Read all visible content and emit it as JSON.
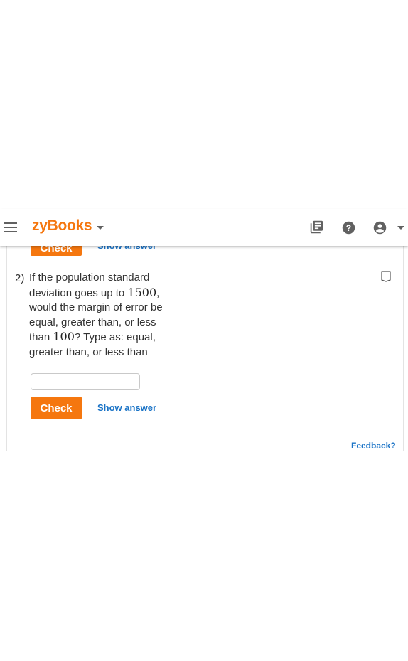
{
  "header": {
    "brand": "zyBooks",
    "menu_icon": "hamburger-menu-icon",
    "library_icon": "library-books-icon",
    "help_icon": "help-circle-icon",
    "user_icon": "account-circle-icon"
  },
  "previous_question": {
    "check_label": "Check",
    "show_answer_label": "Show answer"
  },
  "question": {
    "number": "2)",
    "text_part1": "If the population standard deviation goes up to ",
    "value1": "1500",
    "text_part2": ", would the margin of error be equal, greater than, or less than ",
    "value2": "100",
    "text_part3": "? Type as: equal, greater than, or less than",
    "answer_value": "",
    "check_label": "Check",
    "show_answer_label": "Show answer"
  },
  "feedback_label": "Feedback?",
  "colors": {
    "brand_orange": "#f5770f",
    "link_blue": "#1a73c6",
    "icon_gray": "#616161"
  }
}
